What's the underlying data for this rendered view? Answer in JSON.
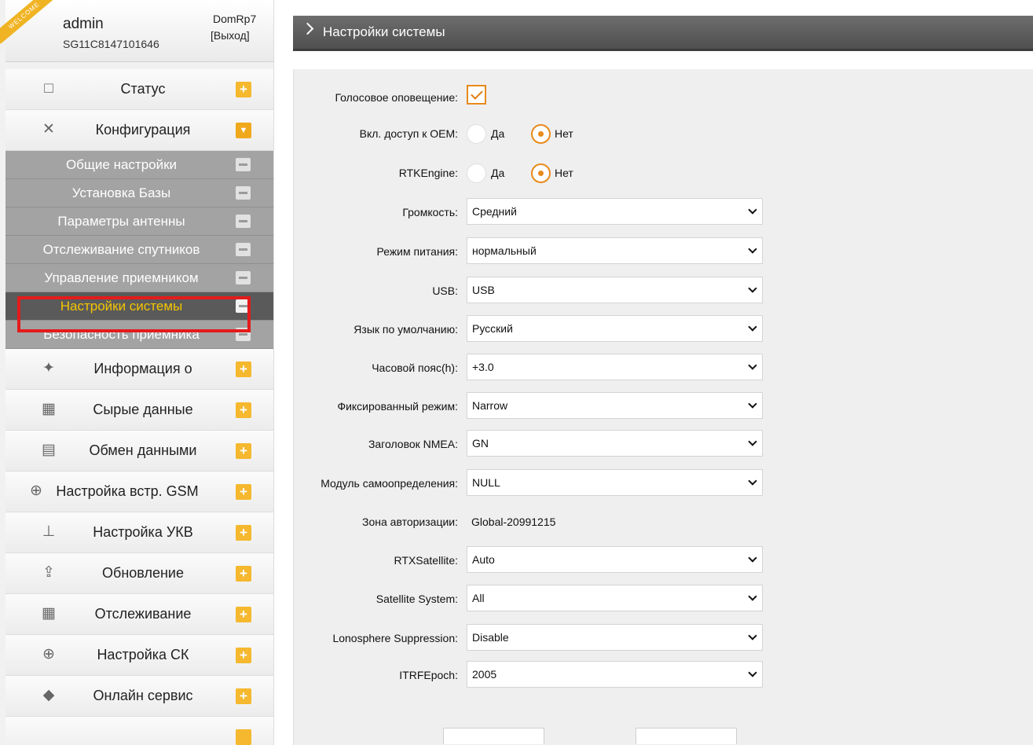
{
  "user": {
    "ribbon": "WELCOME",
    "name": "admin",
    "device_id": "SG11C8147101646",
    "hostname": "DomRp7",
    "logout": "[Выход]"
  },
  "sidebar": {
    "top_items": [
      {
        "label": "Статус",
        "icon": "monitor-icon"
      },
      {
        "label": "Конфигурация",
        "icon": "tools-icon"
      }
    ],
    "sub_items": [
      {
        "label": "Общие настройки"
      },
      {
        "label": "Установка Базы"
      },
      {
        "label": "Параметры антенны"
      },
      {
        "label": "Отслеживание спутников"
      },
      {
        "label": "Управление приемником"
      },
      {
        "label": "Настройки системы",
        "active": true
      },
      {
        "label": "Безопасность приемника"
      }
    ],
    "bottom_items": [
      {
        "label": "Информация о",
        "icon": "satellite-icon"
      },
      {
        "label": "Сырые данные",
        "icon": "calendar-icon"
      },
      {
        "label": "Обмен данными",
        "icon": "network-icon"
      },
      {
        "label": "Настройка встр. GSM",
        "icon": "globe-icon"
      },
      {
        "label": "Настройка УКВ",
        "icon": "antenna-icon"
      },
      {
        "label": "Обновление",
        "icon": "upload-icon"
      },
      {
        "label": "Отслеживание",
        "icon": "calendar-icon"
      },
      {
        "label": "Настройка СК",
        "icon": "globe-icon"
      },
      {
        "label": "Онлайн сервис",
        "icon": "cube-icon"
      }
    ],
    "accent_color": "#f5b82e",
    "highlight_color": "#e41b1b"
  },
  "main": {
    "title": "Настройки системы",
    "voice": {
      "label": "Голосовое оповещение:",
      "checked": true
    },
    "oem": {
      "label": "Вкл. доступ к OEM:",
      "yes": "Да",
      "no": "Нет",
      "value": "no"
    },
    "rtk": {
      "label": "RTKEngine:",
      "yes": "Да",
      "no": "Нет",
      "value": "no"
    },
    "volume": {
      "label": "Громкость:",
      "value": "Средний"
    },
    "power": {
      "label": "Режим питания:",
      "value": "нормальный"
    },
    "usb": {
      "label": "USB:",
      "value": "USB"
    },
    "language": {
      "label": "Язык по умолчанию:",
      "value": "Русский"
    },
    "timezone": {
      "label": "Часовой пояс(h):",
      "value": "+3.0"
    },
    "fixed_mode": {
      "label": "Фиксированный режим:",
      "value": "Narrow"
    },
    "nmea": {
      "label": "Заголовок NMEA:",
      "value": "GN"
    },
    "self_module": {
      "label": "Модуль самоопределения:",
      "value": "NULL"
    },
    "auth_zone": {
      "label": "Зона авторизации:",
      "value": "Global-20991215"
    },
    "rtx": {
      "label": "RTXSatellite:",
      "value": "Auto"
    },
    "sat_system": {
      "label": "Satellite System:",
      "value": "All"
    },
    "iono": {
      "label": "Lonosphere Suppression:",
      "value": "Disable"
    },
    "itrf": {
      "label": "ITRFEpoch:",
      "value": "2005"
    }
  }
}
